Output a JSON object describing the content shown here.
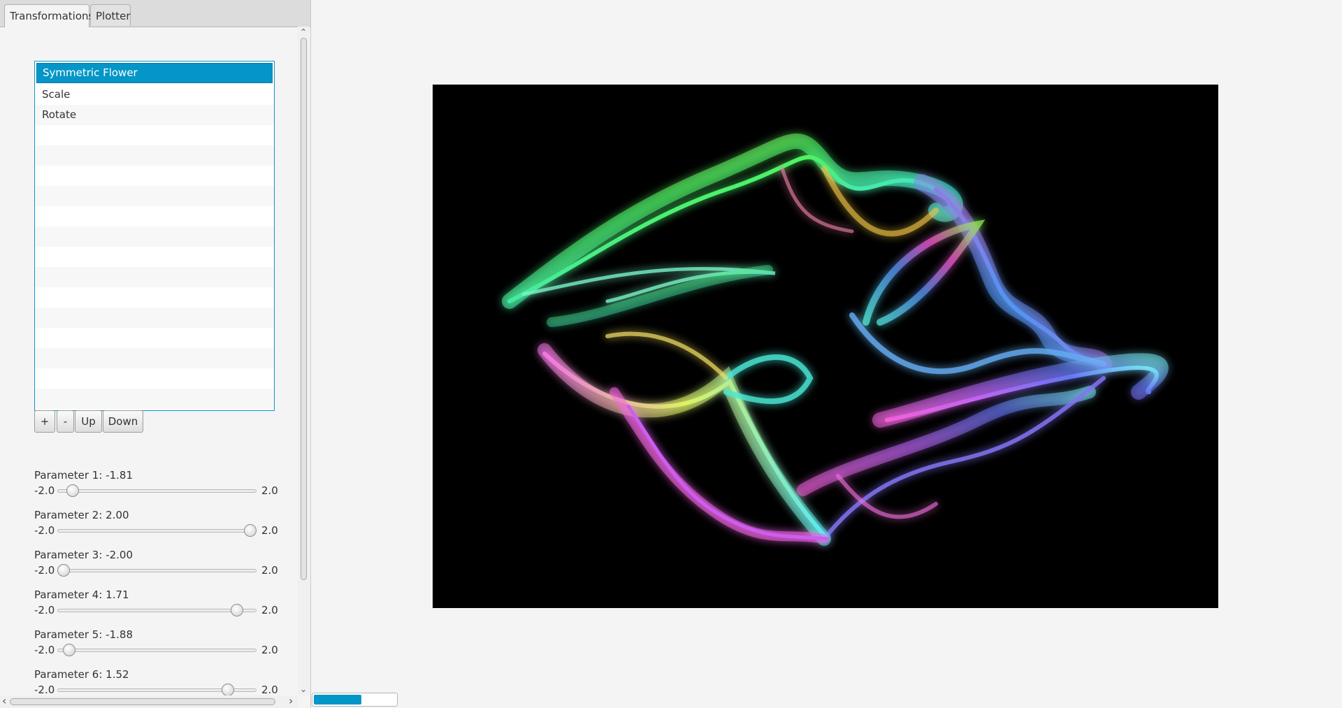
{
  "tabs": [
    {
      "label": "Transformations",
      "active": true
    },
    {
      "label": "Plotter",
      "active": false
    }
  ],
  "transform_list": {
    "items": [
      "Symmetric Flower",
      "Scale",
      "Rotate"
    ],
    "selected_index": 0
  },
  "list_buttons": {
    "add": "+",
    "remove": "-",
    "up": "Up",
    "down": "Down"
  },
  "parameters": [
    {
      "label": "Parameter 1: -1.81",
      "min": "-2.0",
      "max": "2.0",
      "value": -1.81
    },
    {
      "label": "Parameter 2: 2.00",
      "min": "-2.0",
      "max": "2.0",
      "value": 2.0
    },
    {
      "label": "Parameter 3: -2.00",
      "min": "-2.0",
      "max": "2.0",
      "value": -2.0
    },
    {
      "label": "Parameter 4: 1.71",
      "min": "-2.0",
      "max": "2.0",
      "value": 1.71
    },
    {
      "label": "Parameter 5: -1.88",
      "min": "-2.0",
      "max": "2.0",
      "value": -1.88
    },
    {
      "label": "Parameter 6: 1.52",
      "min": "-2.0",
      "max": "2.0",
      "value": 1.52
    }
  ],
  "scrollbars": {
    "up_arrow": "⌃",
    "down_arrow": "⌄",
    "left_arrow": "‹",
    "right_arrow": "›"
  },
  "render_progress": 0.58,
  "colors": {
    "accent": "#0496c7",
    "canvas_bg": "#000000",
    "panel_bg": "#f4f4f4"
  }
}
